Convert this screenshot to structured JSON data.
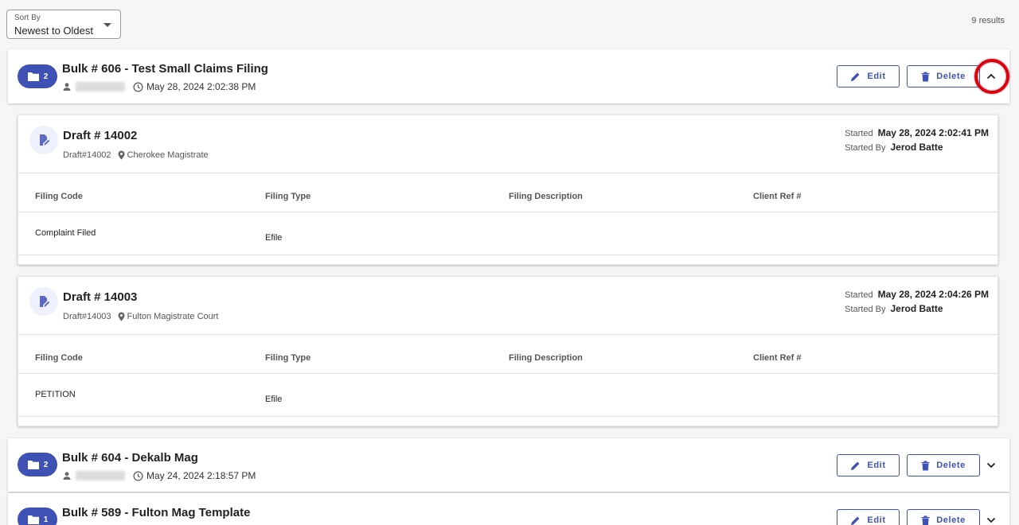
{
  "sort": {
    "label": "Sort By",
    "value": "Newest to Oldest"
  },
  "results": "9 results",
  "actions": {
    "edit_label": "Edit",
    "delete_label": "Delete"
  },
  "colors": {
    "primary": "#3f51b5",
    "highlight": "#e0000d"
  },
  "table_headers": [
    "Filing Code",
    "Filing Type",
    "Filing Description",
    "Client Ref #"
  ],
  "bulks": [
    {
      "count": "2",
      "title": "Bulk # 606 - Test Small Claims Filing",
      "date": "May 28, 2024 2:02:38 PM",
      "expanded": true,
      "drafts": [
        {
          "title": "Draft # 14002",
          "id": "Draft#14002",
          "location": "Cherokee Magistrate",
          "started_label": "Started",
          "started": "May 28, 2024 2:02:41 PM",
          "started_by_label": "Started By",
          "started_by": "Jerod Batte",
          "filing_code": "Complaint Filed",
          "filing_type": "Efile",
          "filing_description": "",
          "client_ref": ""
        },
        {
          "title": "Draft # 14003",
          "id": "Draft#14003",
          "location": "Fulton Magistrate Court",
          "started_label": "Started",
          "started": "May 28, 2024 2:04:26 PM",
          "started_by_label": "Started By",
          "started_by": "Jerod Batte",
          "filing_code": "PETITION",
          "filing_type": "Efile",
          "filing_description": "",
          "client_ref": ""
        }
      ]
    },
    {
      "count": "2",
      "title": "Bulk # 604 - Dekalb Mag",
      "date": "May 24, 2024 2:18:57 PM",
      "expanded": false
    },
    {
      "count": "1",
      "title": "Bulk # 589 - Fulton Mag Template",
      "date": "",
      "expanded": false
    }
  ]
}
